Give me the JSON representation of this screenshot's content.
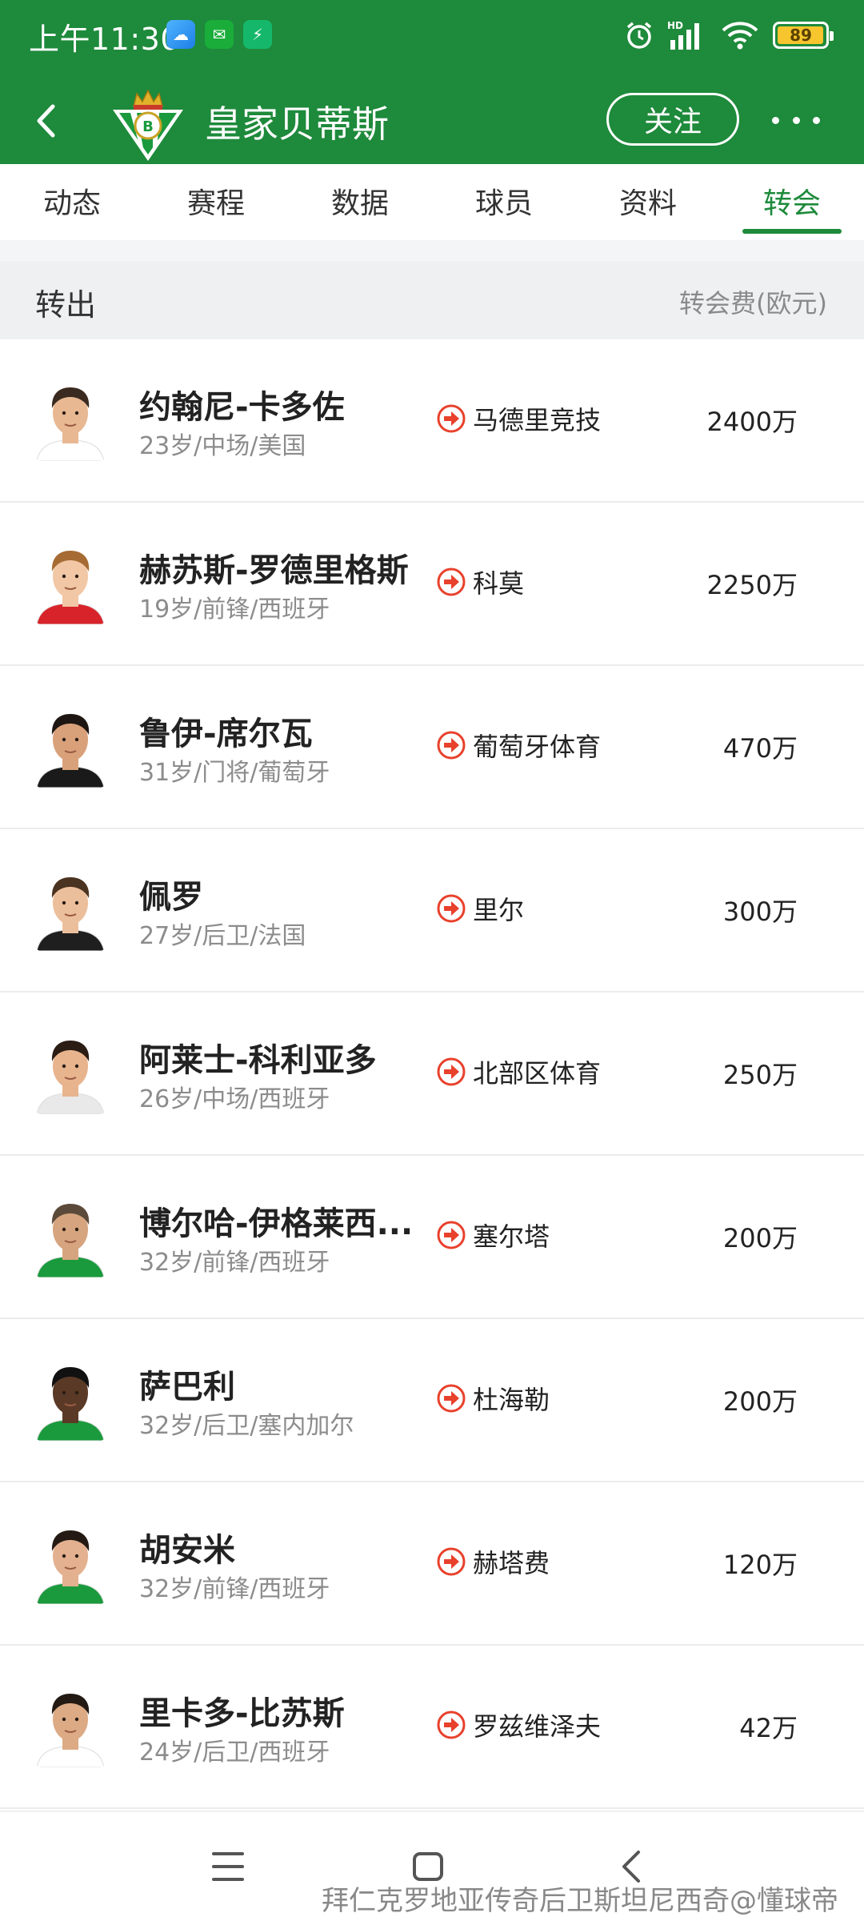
{
  "status_bar": {
    "time": "上午11:30",
    "battery": "89"
  },
  "header": {
    "team_name": "皇家贝蒂斯",
    "follow_label": "关注"
  },
  "tabs": [
    {
      "label": "动态",
      "active": false
    },
    {
      "label": "赛程",
      "active": false
    },
    {
      "label": "数据",
      "active": false
    },
    {
      "label": "球员",
      "active": false
    },
    {
      "label": "资料",
      "active": false
    },
    {
      "label": "转会",
      "active": true
    }
  ],
  "section": {
    "title": "转出",
    "fee_label": "转会费(欧元)"
  },
  "transfers": [
    {
      "name": "约翰尼-卡多佐",
      "meta": "23岁/中场/美国",
      "club": "马德里竞技",
      "fee": "2400万"
    },
    {
      "name": "赫苏斯-罗德里格斯",
      "meta": "19岁/前锋/西班牙",
      "club": "科莫",
      "fee": "2250万"
    },
    {
      "name": "鲁伊-席尔瓦",
      "meta": "31岁/门将/葡萄牙",
      "club": "葡萄牙体育",
      "fee": "470万"
    },
    {
      "name": "佩罗",
      "meta": "27岁/后卫/法国",
      "club": "里尔",
      "fee": "300万"
    },
    {
      "name": "阿莱士-科利亚多",
      "meta": "26岁/中场/西班牙",
      "club": "北部区体育",
      "fee": "250万"
    },
    {
      "name": "博尔哈-伊格莱西...",
      "meta": "32岁/前锋/西班牙",
      "club": "塞尔塔",
      "fee": "200万"
    },
    {
      "name": "萨巴利",
      "meta": "32岁/后卫/塞内加尔",
      "club": "杜海勒",
      "fee": "200万"
    },
    {
      "name": "胡安米",
      "meta": "32岁/前锋/西班牙",
      "club": "赫塔费",
      "fee": "120万"
    },
    {
      "name": "里卡多-比苏斯",
      "meta": "24岁/后卫/西班牙",
      "club": "罗兹维泽夫",
      "fee": "42万"
    }
  ],
  "watermark": "拜仁克罗地亚传奇后卫斯坦尼西奇@懂球帝",
  "colors": {
    "brand_green": "#1e8a3b",
    "arrow_red": "#e8412c"
  }
}
